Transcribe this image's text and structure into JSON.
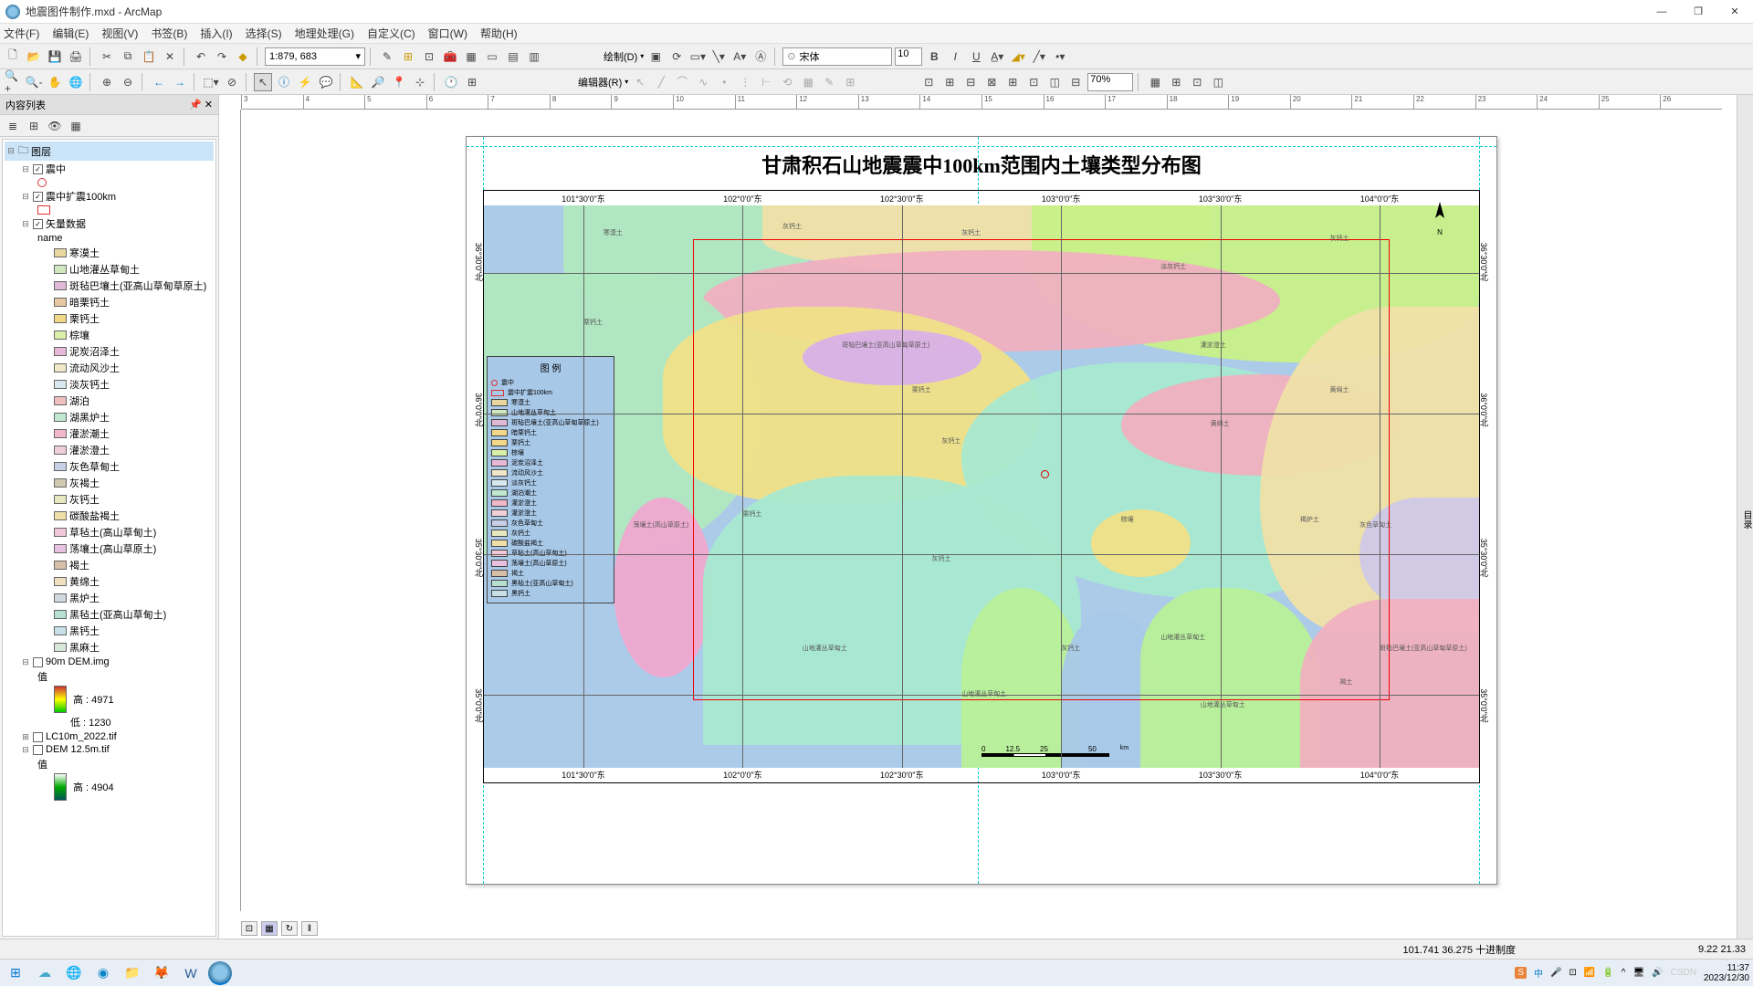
{
  "window": {
    "title": "地震图件制作.mxd - ArcMap"
  },
  "menu": [
    "文件(F)",
    "编辑(E)",
    "视图(V)",
    "书签(B)",
    "插入(I)",
    "选择(S)",
    "地理处理(G)",
    "自定义(C)",
    "窗口(W)",
    "帮助(H)"
  ],
  "toolbar1": {
    "scale": "1:879, 683",
    "draw_label": "绘制(D)",
    "edit_label": "编辑器(R)",
    "font": "宋体",
    "font_size": "10",
    "percent": "70%"
  },
  "toc": {
    "title": "内容列表",
    "root": "图层",
    "layers": {
      "zhenzhong": "震中",
      "zhenzhong100": "震中扩震100km",
      "shiliang": "矢量数据",
      "name_field": "name",
      "dem90": "90m DEM.img",
      "dem90_val": "值",
      "dem90_hi": "高 : 4971",
      "dem90_lo": "低 : 1230",
      "lc10": "LC10m_2022.tif",
      "dem125": "DEM 12.5m.tif",
      "dem125_val": "值",
      "dem125_hi": "高 : 4904"
    },
    "soil_types": [
      {
        "label": "寒漠土",
        "color": "#e8d8a0"
      },
      {
        "label": "山地灌丛草甸土",
        "color": "#d0e8c0"
      },
      {
        "label": "斑毡巴壤土(亚高山草甸草原土)",
        "color": "#e0b8d8"
      },
      {
        "label": "暗栗钙土",
        "color": "#e8c8a0"
      },
      {
        "label": "栗钙土",
        "color": "#f0d888"
      },
      {
        "label": "棕壤",
        "color": "#d8f0a8"
      },
      {
        "label": "泥炭沼泽土",
        "color": "#e8b8d8"
      },
      {
        "label": "流动风沙土",
        "color": "#f0e8c8"
      },
      {
        "label": "淡灰钙土",
        "color": "#d8e8f0"
      },
      {
        "label": "湖泊",
        "color": "#f0c0c0"
      },
      {
        "label": "湖黑炉土",
        "color": "#c0e8d0"
      },
      {
        "label": "灌淤潮土",
        "color": "#f0b8c8"
      },
      {
        "label": "灌淤澄土",
        "color": "#f0d0d8"
      },
      {
        "label": "灰色草甸土",
        "color": "#c8d0e8"
      },
      {
        "label": "灰褐土",
        "color": "#d0c8b0"
      },
      {
        "label": "灰钙土",
        "color": "#e8e8c0"
      },
      {
        "label": "碳酸盐褐土",
        "color": "#f0e0a8"
      },
      {
        "label": "草毡土(高山草甸土)",
        "color": "#f0c8d8"
      },
      {
        "label": "荡壤土(高山草原土)",
        "color": "#e8c0e0"
      },
      {
        "label": "褐土",
        "color": "#d8c0a8"
      },
      {
        "label": "黄绵土",
        "color": "#f0e0c0"
      },
      {
        "label": "黑炉土",
        "color": "#d0d8e0"
      },
      {
        "label": "黑毡土(亚高山草甸土)",
        "color": "#b8e0d0"
      },
      {
        "label": "黑钙土",
        "color": "#c8e0e8"
      },
      {
        "label": "黑麻土",
        "color": "#d8e8d8"
      }
    ]
  },
  "map": {
    "title": "甘肃积石山地震震中100km范围内土壤类型分布图",
    "legend_title": "图 例",
    "lon_labels": [
      "101°30'0\"东",
      "102°0'0\"东",
      "102°30'0\"东",
      "103°0'0\"东",
      "103°30'0\"东",
      "104°0'0\"东"
    ],
    "lat_labels": [
      "36°30'0\"北",
      "36°0'0\"北",
      "35°30'0\"北",
      "35°0'0\"北"
    ],
    "scalebar_vals": [
      "0",
      "12.5",
      "25",
      "50"
    ],
    "legend_items": [
      {
        "label": "震中",
        "type": "circle"
      },
      {
        "label": "震中扩震100km",
        "type": "box"
      },
      {
        "label": "寒漠土",
        "color": "#e8d8a0"
      },
      {
        "label": "山地灌丛草甸土",
        "color": "#d0e8c0"
      },
      {
        "label": "斑毡巴壤土(亚高山草甸草原土)",
        "color": "#e0b8d8"
      },
      {
        "label": "暗栗钙土",
        "color": "#f0d888"
      },
      {
        "label": "栗钙土",
        "color": "#f0d888"
      },
      {
        "label": "棕壤",
        "color": "#d8f0a8"
      },
      {
        "label": "泥炭沼泽土",
        "color": "#e8b8d8"
      },
      {
        "label": "流动风沙土",
        "color": "#f0e8c8"
      },
      {
        "label": "淡灰钙土",
        "color": "#d8e8f0"
      },
      {
        "label": "湖泊潮土",
        "color": "#c0e8d0"
      },
      {
        "label": "灌淤澄土",
        "color": "#f0b8c8"
      },
      {
        "label": "灌淤澄土",
        "color": "#f0d0d8"
      },
      {
        "label": "灰色草甸土",
        "color": "#c8d0e8"
      },
      {
        "label": "灰钙土",
        "color": "#e8e8c0"
      },
      {
        "label": "碳酸盐褐土",
        "color": "#f0e0a8"
      },
      {
        "label": "草毡土(高山草甸土)",
        "color": "#f0c8d8"
      },
      {
        "label": "荡壤土(高山草原土)",
        "color": "#e8c0e0"
      },
      {
        "label": "褐土",
        "color": "#d8c0a8"
      },
      {
        "label": "黑毡土(亚高山草甸土)",
        "color": "#b8e0d0"
      },
      {
        "label": "黑钙土",
        "color": "#c8e0e8"
      }
    ]
  },
  "status": {
    "coords": "101.741  36.275 十进制度",
    "extra": "9.22  21.33"
  },
  "tray": {
    "time": "11:37",
    "date": "2023/12/30",
    "watermark": "CSDN"
  }
}
